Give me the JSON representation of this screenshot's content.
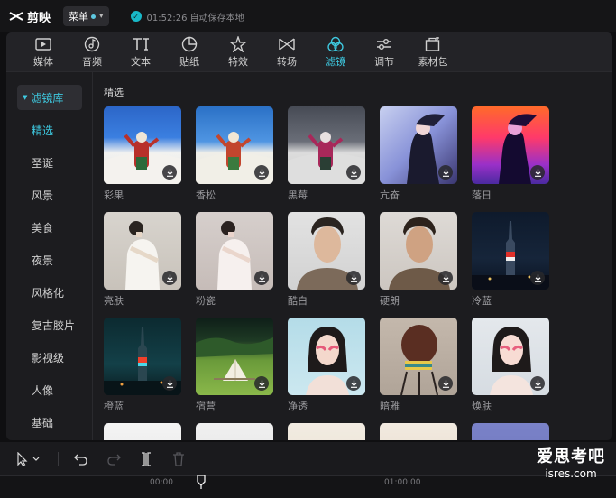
{
  "app": {
    "name": "剪映",
    "menu_label": "菜单",
    "autosave_text": "01:52:26 自动保存本地"
  },
  "toolbar": {
    "items": [
      {
        "label": "媒体",
        "icon": "media-icon"
      },
      {
        "label": "音频",
        "icon": "audio-icon"
      },
      {
        "label": "文本",
        "icon": "text-icon"
      },
      {
        "label": "贴纸",
        "icon": "sticker-icon"
      },
      {
        "label": "特效",
        "icon": "effects-icon"
      },
      {
        "label": "转场",
        "icon": "transition-icon"
      },
      {
        "label": "滤镜",
        "icon": "filter-icon",
        "active": true
      },
      {
        "label": "调节",
        "icon": "adjust-icon"
      },
      {
        "label": "素材包",
        "icon": "package-icon"
      }
    ]
  },
  "sidebar": {
    "library_label": "滤镜库",
    "categories": [
      "精选",
      "圣诞",
      "风景",
      "美食",
      "夜景",
      "风格化",
      "复古胶片",
      "影视级",
      "人像",
      "基础"
    ],
    "active": "精选"
  },
  "content": {
    "section_title": "精选",
    "filters": [
      "彩果",
      "香松",
      "黑莓",
      "亢奋",
      "落日",
      "亮肤",
      "粉瓷",
      "酷白",
      "硬朗",
      "冷蓝",
      "橙蓝",
      "宿营",
      "净透",
      "暗雅",
      "焕肤"
    ]
  },
  "timeline": {
    "ticks": [
      "00:00",
      "01:00:00"
    ]
  },
  "watermark": {
    "line1": "爱思考吧",
    "line2": "isres.com"
  },
  "colors": {
    "accent": "#3ec9e0",
    "background": "#1c1c1f"
  }
}
